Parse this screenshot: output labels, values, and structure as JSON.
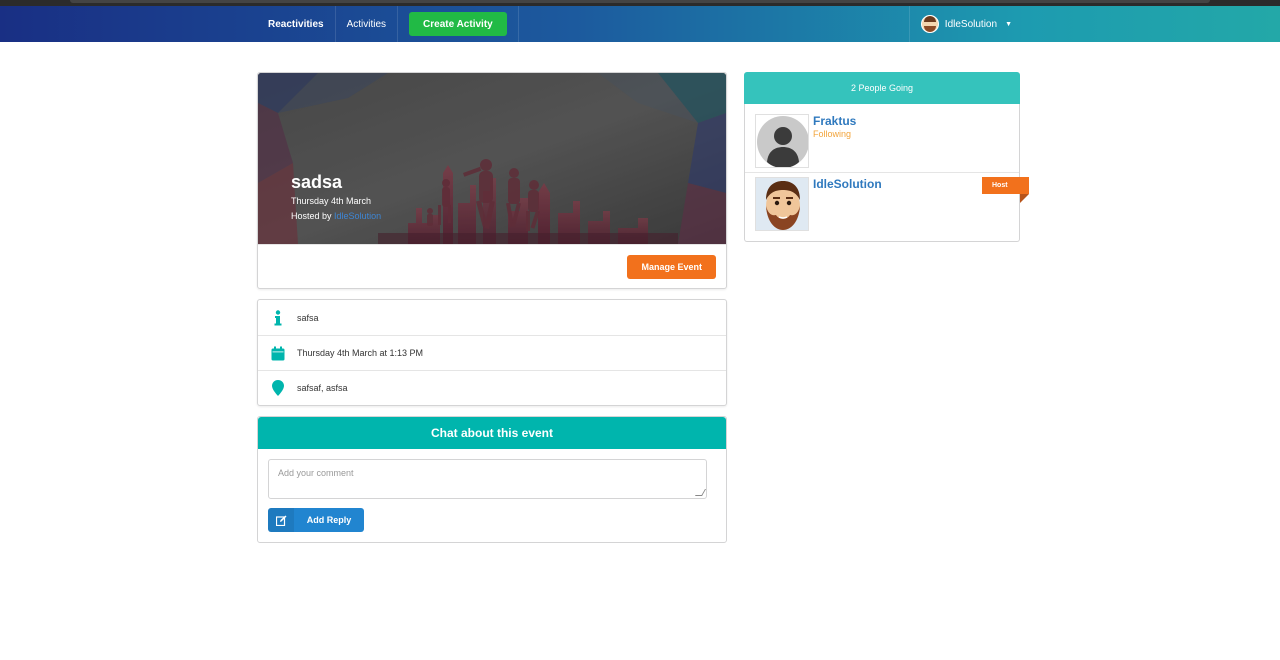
{
  "nav": {
    "brand": "Reactivities",
    "activities": "Activities",
    "create_activity": "Create Activity",
    "username": "IdleSolution"
  },
  "activity": {
    "title": "sadsa",
    "date": "Thursday 4th March",
    "hosted_by_prefix": "Hosted by",
    "host_name": "IdleSolution",
    "manage_label": "Manage Event"
  },
  "details": {
    "description": "safsa",
    "datetime": "Thursday 4th March at 1:13 PM",
    "venue": "safsaf, asfsa"
  },
  "chat": {
    "header": "Chat about this event",
    "placeholder": "Add your comment",
    "reply_label": "Add Reply"
  },
  "sidebar": {
    "header": "2 People Going",
    "attendees": [
      {
        "name": "Fraktus",
        "status": "Following"
      },
      {
        "name": "IdleSolution",
        "status": "",
        "tag": "Host"
      }
    ]
  },
  "colors": {
    "teal": "#00b5ad",
    "orange": "#f2711c",
    "green": "#21ba45",
    "blue": "#2185d0"
  }
}
